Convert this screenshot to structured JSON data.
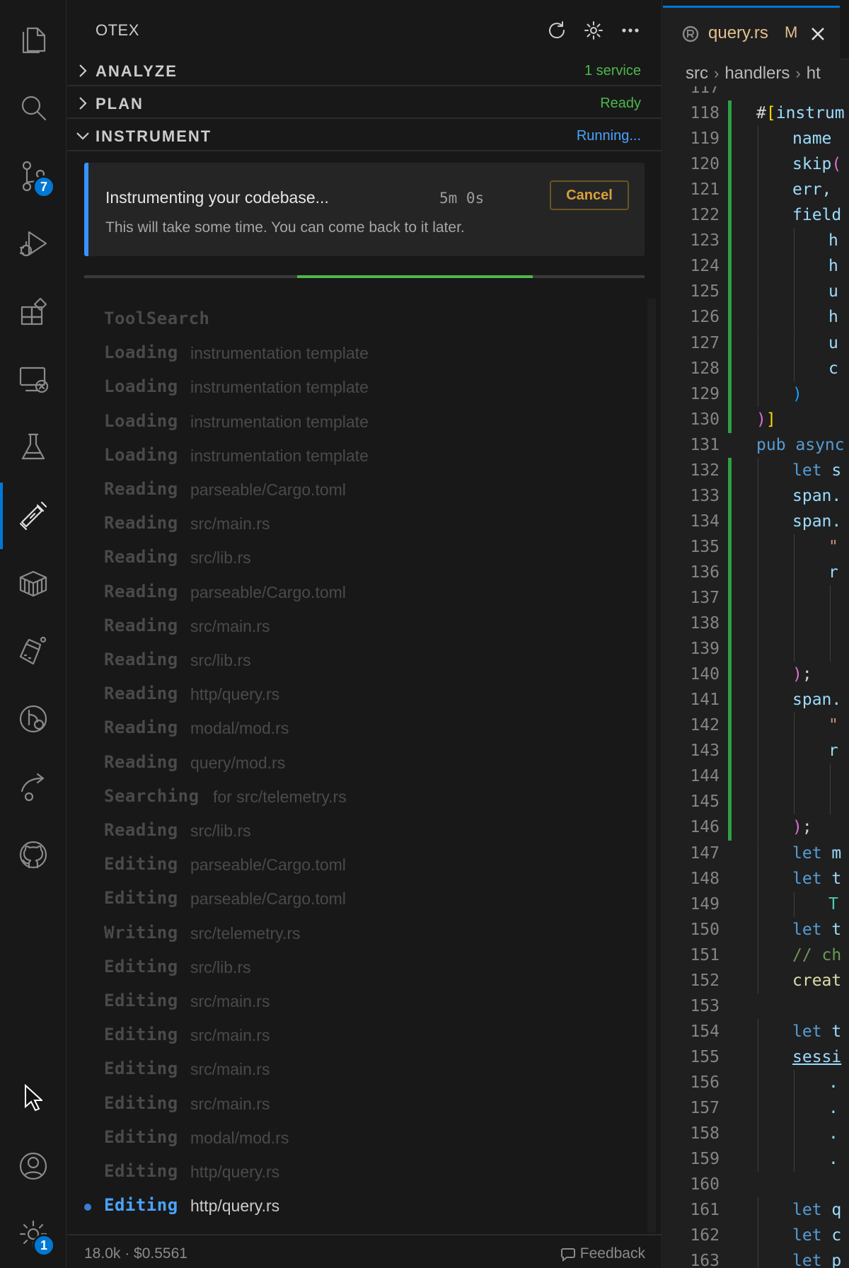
{
  "activity_bar": {
    "scm_badge": "7",
    "settings_badge": "1",
    "icons": [
      "explorer-icon",
      "search-icon",
      "source-control-icon",
      "run-debug-icon",
      "extensions-icon",
      "remote-explorer-icon",
      "testing-icon",
      "otex-icon",
      "containers-icon",
      "lab-icon",
      "timeline-icon",
      "share-icon",
      "github-icon",
      "accounts-icon",
      "settings-gear-icon"
    ]
  },
  "sidebar": {
    "title": "OTEX",
    "sections": [
      {
        "name": "ANALYZE",
        "status": "1 service",
        "status_color": "#4cb84c",
        "expanded": false
      },
      {
        "name": "PLAN",
        "status": "Ready",
        "status_color": "#4cb84c",
        "expanded": false
      },
      {
        "name": "INSTRUMENT",
        "status": "Running...",
        "status_color": "#4aa3ff",
        "expanded": true
      }
    ],
    "notice": {
      "title": "Instrumenting your codebase...",
      "timer": "5m 0s",
      "cancel_label": "Cancel",
      "subtitle": "This will take some time. You can come back to it later."
    },
    "progress": {
      "start_fraction": 0.38,
      "end_fraction": 0.8
    },
    "log": [
      {
        "verb": "ToolSearch",
        "target": ""
      },
      {
        "verb": "Loading",
        "target": "instrumentation template"
      },
      {
        "verb": "Loading",
        "target": "instrumentation template"
      },
      {
        "verb": "Loading",
        "target": "instrumentation template"
      },
      {
        "verb": "Loading",
        "target": "instrumentation template"
      },
      {
        "verb": "Reading",
        "target": "parseable/Cargo.toml"
      },
      {
        "verb": "Reading",
        "target": "src/main.rs"
      },
      {
        "verb": "Reading",
        "target": "src/lib.rs"
      },
      {
        "verb": "Reading",
        "target": "parseable/Cargo.toml"
      },
      {
        "verb": "Reading",
        "target": "src/main.rs"
      },
      {
        "verb": "Reading",
        "target": "src/lib.rs"
      },
      {
        "verb": "Reading",
        "target": "http/query.rs"
      },
      {
        "verb": "Reading",
        "target": "modal/mod.rs"
      },
      {
        "verb": "Reading",
        "target": "query/mod.rs"
      },
      {
        "verb": "Searching",
        "target": "for src/telemetry.rs"
      },
      {
        "verb": "Reading",
        "target": "src/lib.rs"
      },
      {
        "verb": "Editing",
        "target": "parseable/Cargo.toml"
      },
      {
        "verb": "Editing",
        "target": "parseable/Cargo.toml"
      },
      {
        "verb": "Writing",
        "target": "src/telemetry.rs"
      },
      {
        "verb": "Editing",
        "target": "src/lib.rs"
      },
      {
        "verb": "Editing",
        "target": "src/main.rs"
      },
      {
        "verb": "Editing",
        "target": "src/main.rs"
      },
      {
        "verb": "Editing",
        "target": "src/main.rs"
      },
      {
        "verb": "Editing",
        "target": "src/main.rs"
      },
      {
        "verb": "Editing",
        "target": "modal/mod.rs"
      },
      {
        "verb": "Editing",
        "target": "http/query.rs"
      },
      {
        "verb": "Editing",
        "target": "http/query.rs",
        "current": true
      }
    ],
    "footer": {
      "usage": "18.0k · $0.5561",
      "feedback_label": "Feedback"
    }
  },
  "editor": {
    "tab": {
      "filename": "query.rs",
      "modified": "M"
    },
    "breadcrumbs": [
      "src",
      "handlers",
      "ht"
    ],
    "lines": [
      {
        "n": "117",
        "text": "",
        "add": false
      },
      {
        "n": "118",
        "text": "#[instrum",
        "add": true
      },
      {
        "n": "119",
        "text": "name ",
        "add": true,
        "indent": 1
      },
      {
        "n": "120",
        "text": "skip(",
        "add": true,
        "indent": 1
      },
      {
        "n": "121",
        "text": "err, ",
        "add": true,
        "indent": 1
      },
      {
        "n": "122",
        "text": "field",
        "add": true,
        "indent": 1
      },
      {
        "n": "123",
        "text": "h",
        "add": true,
        "indent": 2
      },
      {
        "n": "124",
        "text": "h",
        "add": true,
        "indent": 2
      },
      {
        "n": "125",
        "text": "u",
        "add": true,
        "indent": 2
      },
      {
        "n": "126",
        "text": "h",
        "add": true,
        "indent": 2
      },
      {
        "n": "127",
        "text": "u",
        "add": true,
        "indent": 2
      },
      {
        "n": "128",
        "text": "c",
        "add": true,
        "indent": 2
      },
      {
        "n": "129",
        "text": ")",
        "add": true,
        "indent": 1
      },
      {
        "n": "130",
        "text": ")]",
        "add": true
      },
      {
        "n": "131",
        "text": "pub async",
        "add": false
      },
      {
        "n": "132",
        "text": "let s",
        "add": true,
        "indent": 1
      },
      {
        "n": "133",
        "text": "span.",
        "add": true,
        "indent": 1
      },
      {
        "n": "134",
        "text": "span.",
        "add": true,
        "indent": 1
      },
      {
        "n": "135",
        "text": "\"",
        "add": true,
        "indent": 2
      },
      {
        "n": "136",
        "text": "r",
        "add": true,
        "indent": 2
      },
      {
        "n": "137",
        "text": "",
        "add": true,
        "indent": 3
      },
      {
        "n": "138",
        "text": "",
        "add": true,
        "indent": 3
      },
      {
        "n": "139",
        "text": "",
        "add": true,
        "indent": 3
      },
      {
        "n": "140",
        "text": ");",
        "add": true,
        "indent": 1
      },
      {
        "n": "141",
        "text": "span.",
        "add": true,
        "indent": 1
      },
      {
        "n": "142",
        "text": "\"",
        "add": true,
        "indent": 2
      },
      {
        "n": "143",
        "text": "r",
        "add": true,
        "indent": 2
      },
      {
        "n": "144",
        "text": "",
        "add": true,
        "indent": 3
      },
      {
        "n": "145",
        "text": "",
        "add": true,
        "indent": 3
      },
      {
        "n": "146",
        "text": ");",
        "add": true,
        "indent": 1
      },
      {
        "n": "147",
        "text": "let m",
        "add": false,
        "indent": 1
      },
      {
        "n": "148",
        "text": "let t",
        "add": false,
        "indent": 1
      },
      {
        "n": "149",
        "text": "T",
        "add": false,
        "indent": 2
      },
      {
        "n": "150",
        "text": "let t",
        "add": false,
        "indent": 1
      },
      {
        "n": "151",
        "text": "// ch",
        "add": false,
        "indent": 1
      },
      {
        "n": "152",
        "text": "creat",
        "add": false,
        "indent": 1
      },
      {
        "n": "153",
        "text": "",
        "add": false
      },
      {
        "n": "154",
        "text": "let t",
        "add": false,
        "indent": 1
      },
      {
        "n": "155",
        "text": "sessi",
        "add": false,
        "indent": 1
      },
      {
        "n": "156",
        "text": ".",
        "add": false,
        "indent": 2
      },
      {
        "n": "157",
        "text": ".",
        "add": false,
        "indent": 2
      },
      {
        "n": "158",
        "text": ".",
        "add": false,
        "indent": 2
      },
      {
        "n": "159",
        "text": ".",
        "add": false,
        "indent": 2
      },
      {
        "n": "160",
        "text": "",
        "add": false
      },
      {
        "n": "161",
        "text": "let q",
        "add": false,
        "indent": 1
      },
      {
        "n": "162",
        "text": "let c",
        "add": false,
        "indent": 1
      },
      {
        "n": "163",
        "text": "let p",
        "add": false,
        "indent": 1
      }
    ]
  }
}
